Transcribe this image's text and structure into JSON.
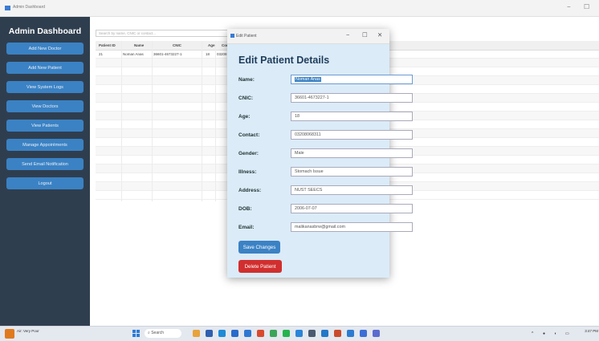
{
  "window": {
    "title": "Admin Dashboard",
    "minimize": "−",
    "maximize": "☐"
  },
  "sidebar": {
    "title": "Admin Dashboard",
    "buttons": [
      "Add New Doctor",
      "Add New Patient",
      "View System Logs",
      "View Doctors",
      "View Patients",
      "Manage Appointments",
      "Send Email Notification",
      "Logout"
    ]
  },
  "search": {
    "placeholder": "Search by name, CNIC or contact..."
  },
  "table": {
    "headers": [
      "Patient ID",
      "Name",
      "CNIC",
      "Age",
      "Con"
    ],
    "rows": [
      [
        "21",
        "Noman Anas",
        "36601-4673227-1",
        "18",
        "03208"
      ]
    ]
  },
  "dialog": {
    "title": "Edit Patient",
    "controls": {
      "minimize": "−",
      "maximize": "☐",
      "close": "✕"
    },
    "heading": "Edit Patient Details",
    "fields": [
      {
        "label": "Name:",
        "value": "Noman Anas"
      },
      {
        "label": "CNIC:",
        "value": "36601-4673227-1"
      },
      {
        "label": "Age:",
        "value": "18"
      },
      {
        "label": "Contact:",
        "value": "03208068311"
      },
      {
        "label": "Gender:",
        "value": "Male"
      },
      {
        "label": "Illness:",
        "value": "Stomach Issue"
      },
      {
        "label": "Address:",
        "value": "NUST SEECS"
      },
      {
        "label": "DOB:",
        "value": "2006-07-07"
      },
      {
        "label": "Email:",
        "value": "malikanasbrw@gmail.com"
      }
    ],
    "save_label": "Save Changes",
    "delete_label": "Delete Patient"
  },
  "taskbar": {
    "weather": "Air: Very Poor",
    "search_label": "Search",
    "clock_time": "3:47 PM",
    "icons": [
      "widgets-icon",
      "file-explorer-icon",
      "edge-icon",
      "store-icon",
      "mail-icon",
      "photos-icon",
      "chrome-icon",
      "spotify-icon",
      "settings-icon",
      "terminal-icon",
      "vscode-icon",
      "office-icon",
      "app-icon",
      "app2-icon",
      "app3-icon"
    ]
  },
  "colors": {
    "sidebar": "#2f3e4f",
    "button": "#3b82c4",
    "danger": "#d12f2f",
    "dialog_bg": "#dbebf8"
  }
}
